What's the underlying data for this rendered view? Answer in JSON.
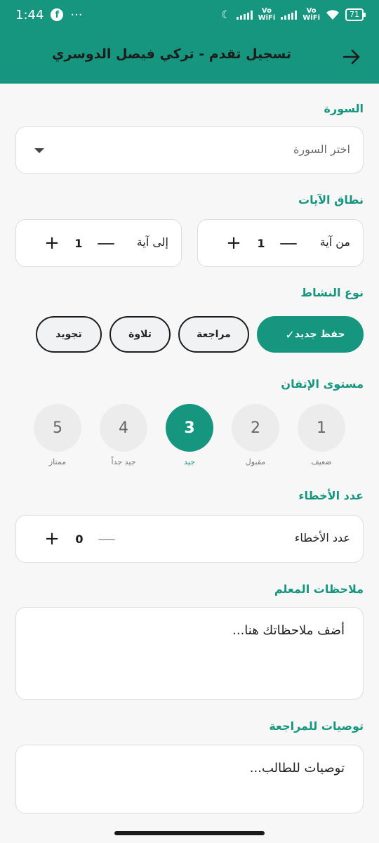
{
  "status_bar": {
    "time": "1:44",
    "fb_icon": "f",
    "dots": "···",
    "vo_wifi_1": "Vo",
    "vo_wifi_1b": "WiFi",
    "vo_wifi_2": "Vo",
    "vo_wifi_2b": "WiFi",
    "battery": "71"
  },
  "app_bar": {
    "title": "تسجيل تقدم - تركي فيصل الدوسري",
    "back_icon": "arrow-right-icon"
  },
  "surah": {
    "label": "السورة",
    "placeholder": "اختر السورة"
  },
  "ayah_range": {
    "label": "نطاق الآيات",
    "from_label": "من آية",
    "from_value": "1",
    "to_label": "إلى آية",
    "to_value": "1",
    "minus": "—",
    "plus": "+"
  },
  "activity": {
    "label": "نوع النشاط",
    "chips": [
      {
        "label": "حفظ جديد",
        "selected": true
      },
      {
        "label": "مراجعة",
        "selected": false
      },
      {
        "label": "تلاوة",
        "selected": false
      },
      {
        "label": "تجويد",
        "selected": false
      }
    ],
    "check": "✓"
  },
  "mastery": {
    "label": "مستوى الإتقان",
    "levels": [
      {
        "num": "1",
        "caption": "ضعيف"
      },
      {
        "num": "2",
        "caption": "مقبول"
      },
      {
        "num": "3",
        "caption": "جيد"
      },
      {
        "num": "4",
        "caption": "جيد جداً"
      },
      {
        "num": "5",
        "caption": "ممتاز"
      }
    ],
    "selected": 3
  },
  "mistakes": {
    "label": "عدد الأخطاء",
    "field_label": "عدد الأخطاء",
    "value": "0",
    "minus": "—",
    "plus": "+"
  },
  "teacher_notes": {
    "label": "ملاحظات المعلم",
    "placeholder": "أضف ملاحظاتك هنا..."
  },
  "recommendations": {
    "label": "توصيات للمراجعة",
    "placeholder": "توصيات للطالب..."
  },
  "colors": {
    "primary": "#17967f",
    "background": "#f7f7f7"
  }
}
